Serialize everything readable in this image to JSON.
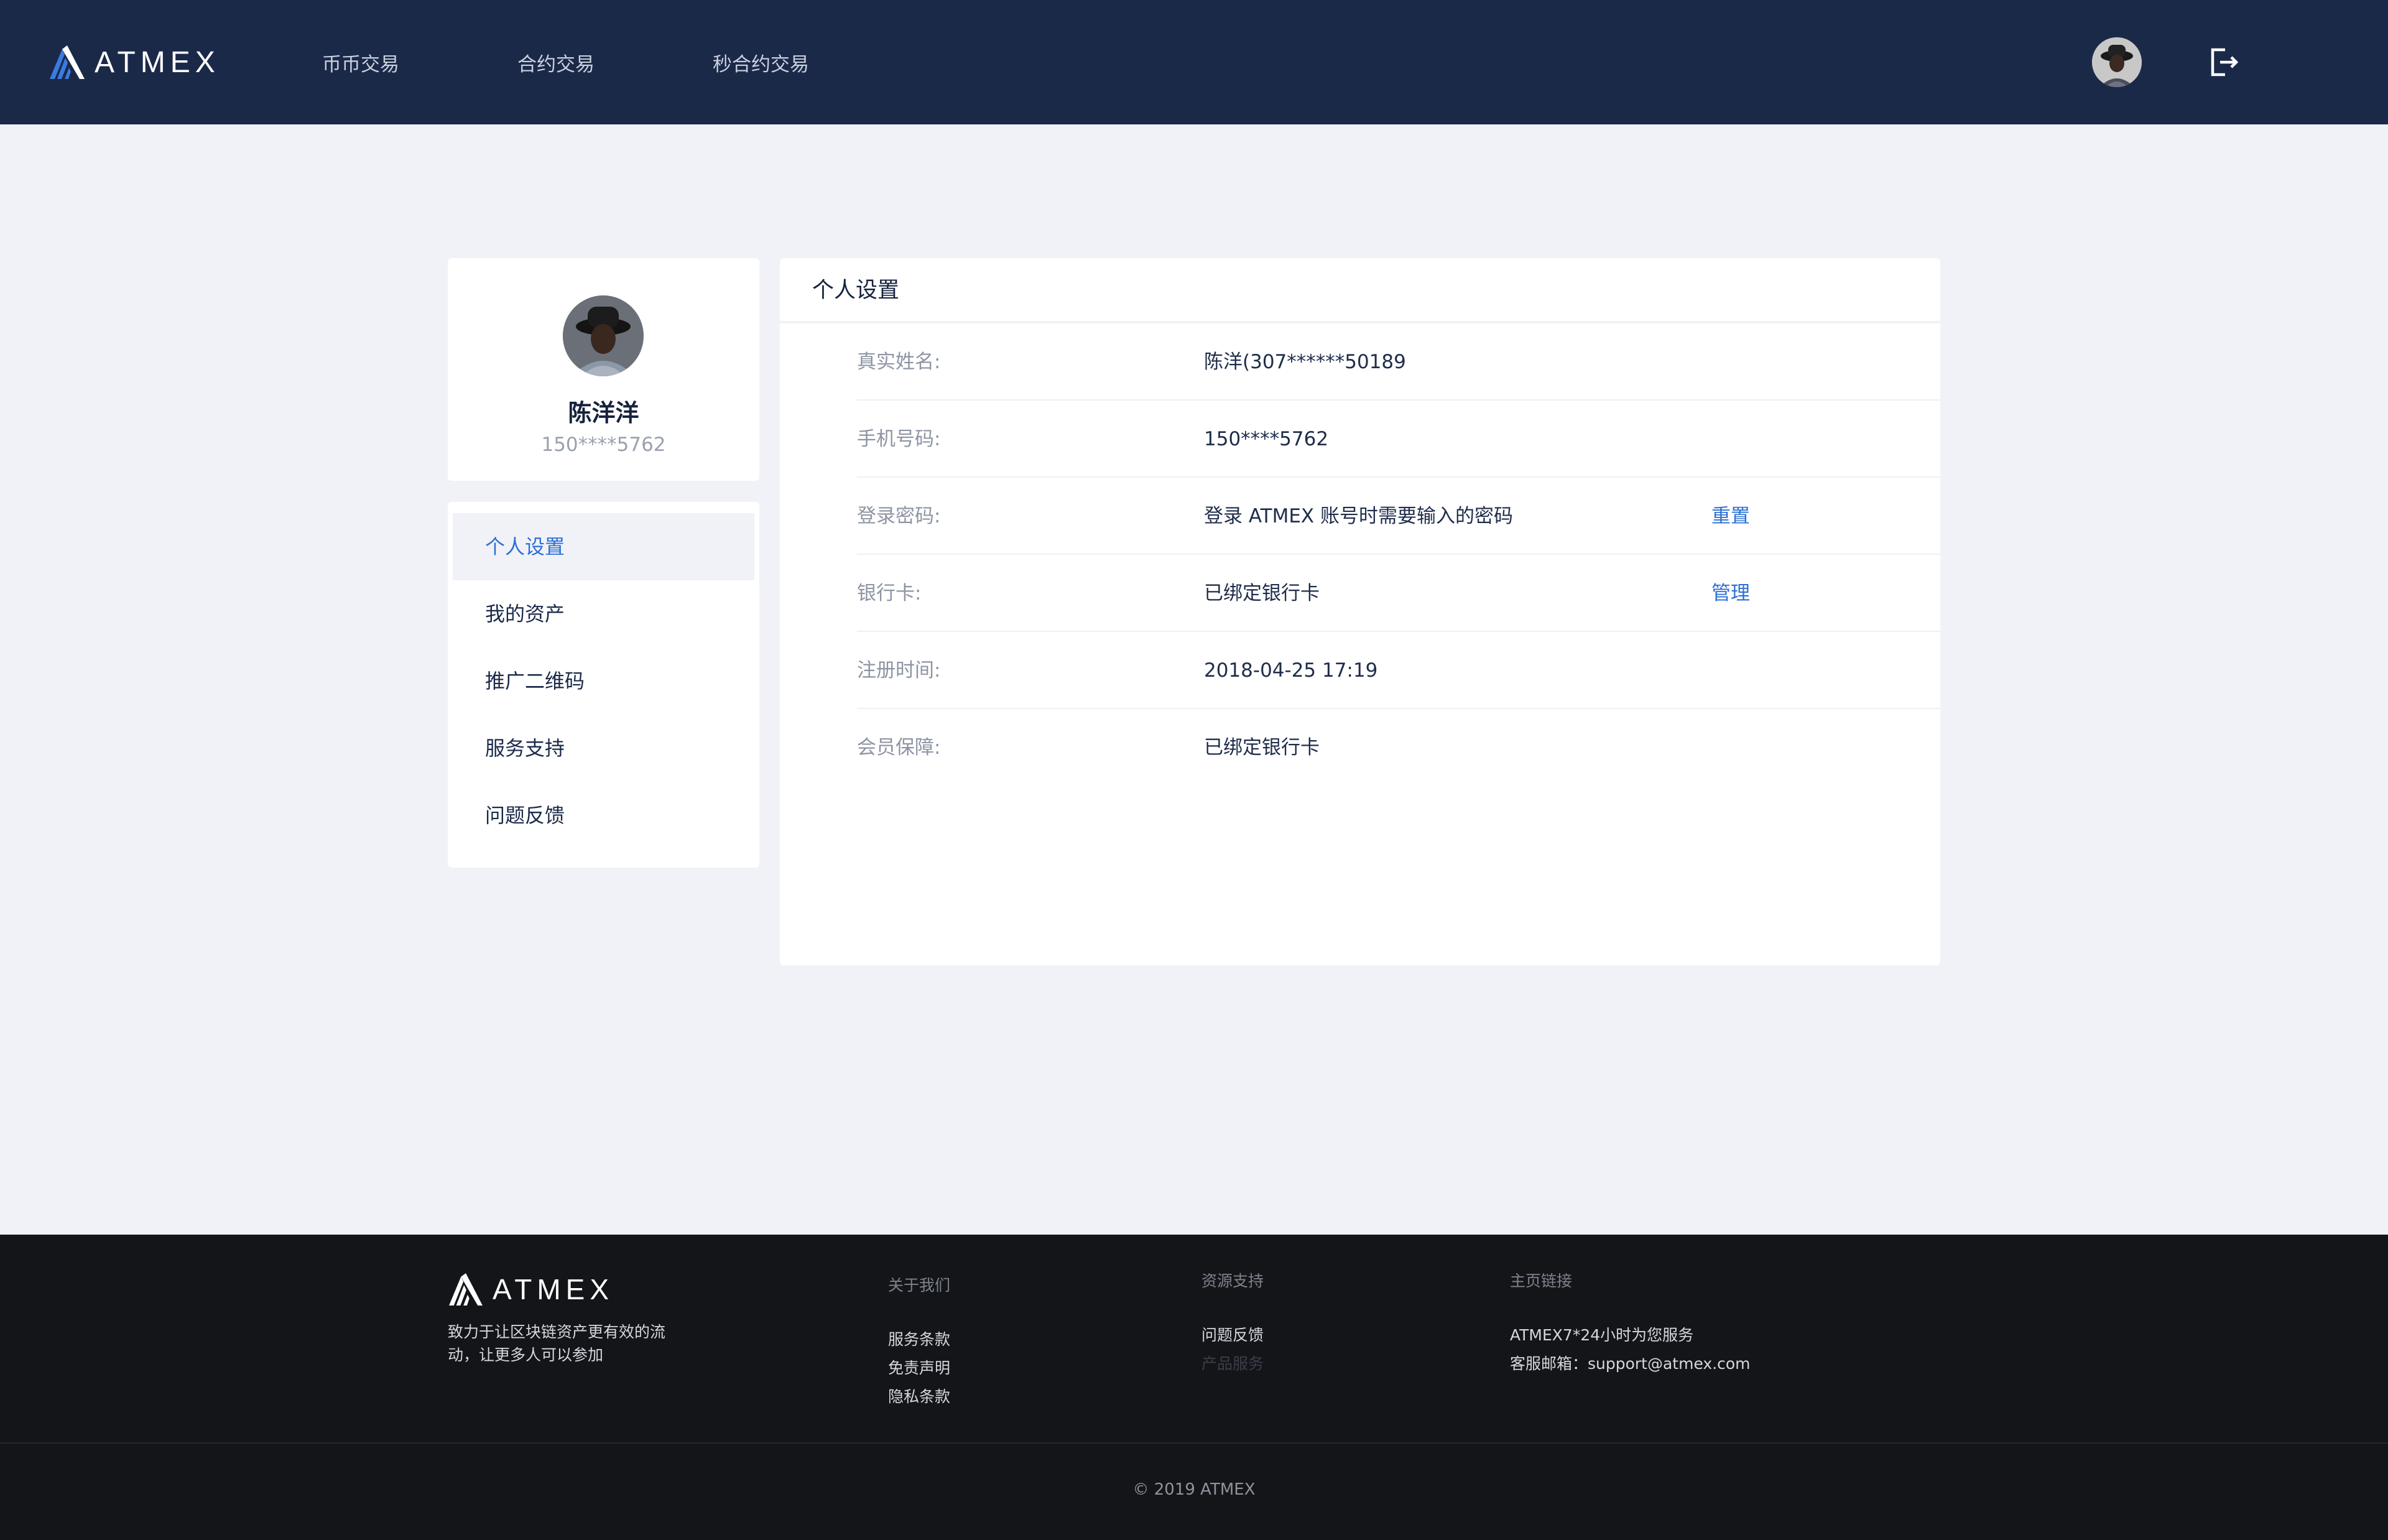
{
  "header": {
    "logo_text": "ATMEX",
    "nav": [
      "币币交易",
      "合约交易",
      "秒合约交易"
    ],
    "avatar_icon": "user-avatar",
    "logout_icon": "logout-icon"
  },
  "profile": {
    "name": "陈洋洋",
    "phone": "150****5762"
  },
  "menu": {
    "items": [
      "个人设置",
      "我的资产",
      "推广二维码",
      "服务支持",
      "问题反馈"
    ],
    "active_index": 0
  },
  "panel": {
    "title": "个人设置",
    "rows": [
      {
        "label": "真实姓名:",
        "value": "陈洋(307******50189",
        "action": ""
      },
      {
        "label": "手机号码:",
        "value": "150****5762",
        "action": ""
      },
      {
        "label": "登录密码:",
        "value": "登录 ATMEX 账号时需要输入的密码",
        "action": "重置"
      },
      {
        "label": "银行卡:",
        "value": "已绑定银行卡",
        "action": "管理"
      },
      {
        "label": "注册时间:",
        "value": "2018-04-25 17:19",
        "action": ""
      },
      {
        "label": "会员保障:",
        "value": "已绑定银行卡",
        "action": ""
      }
    ]
  },
  "footer": {
    "logo_text": "ATMEX",
    "tagline": "致力于让区块链资产更有效的流动，让更多人可以参加",
    "about": {
      "heading": "关于我们",
      "links": [
        "服务条款",
        "免责声明",
        "隐私条款"
      ]
    },
    "resources": {
      "heading": "资源支持",
      "links": [
        "问题反馈",
        "产品服务"
      ]
    },
    "home_links": {
      "heading": "主页链接",
      "lines": [
        "ATMEX7*24小时为您服务",
        "客服邮箱：support@atmex.com"
      ]
    },
    "copyright": "© 2019 ATMEX"
  },
  "colors": {
    "header_bg": "#1b2949",
    "page_bg": "#f1f2f7",
    "accent": "#2c6fd6",
    "footer_bg": "#131519"
  }
}
